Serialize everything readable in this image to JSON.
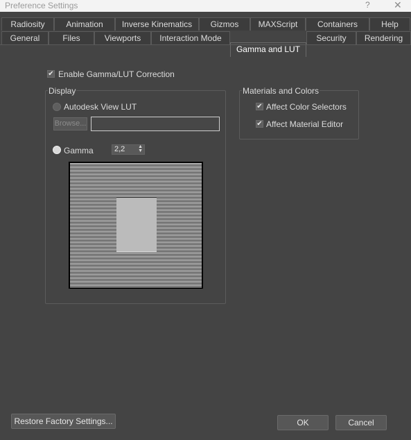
{
  "window": {
    "title": "Preference Settings",
    "help_glyph": "?",
    "close_glyph": "✕"
  },
  "tabs_row1": [
    "Radiosity",
    "Animation",
    "Inverse Kinematics",
    "Gizmos",
    "MAXScript",
    "Containers",
    "Help"
  ],
  "tabs_row2": [
    "General",
    "Files",
    "Viewports",
    "Interaction Mode",
    "Gamma and LUT",
    "Security",
    "Rendering"
  ],
  "active_tab": "Gamma and LUT",
  "enable_gamma": {
    "label": "Enable Gamma/LUT Correction",
    "checked": true
  },
  "display": {
    "group_label": "Display",
    "lut_option": {
      "label": "Autodesk View LUT",
      "selected": false
    },
    "browse_label": "Browse...",
    "lut_path": "",
    "gamma_option": {
      "label": "Gamma",
      "selected": true
    },
    "gamma_value": "2,2"
  },
  "materials": {
    "group_label": "Materials and Colors",
    "affect_color_selectors": {
      "label": "Affect Color Selectors",
      "checked": true
    },
    "affect_material_editor": {
      "label": "Affect Material Editor",
      "checked": true
    }
  },
  "footer": {
    "restore_label": "Restore Factory Settings...",
    "ok_label": "OK",
    "cancel_label": "Cancel"
  },
  "icons": {
    "check_glyph": "✔",
    "spinner_glyph": "▲▼"
  }
}
